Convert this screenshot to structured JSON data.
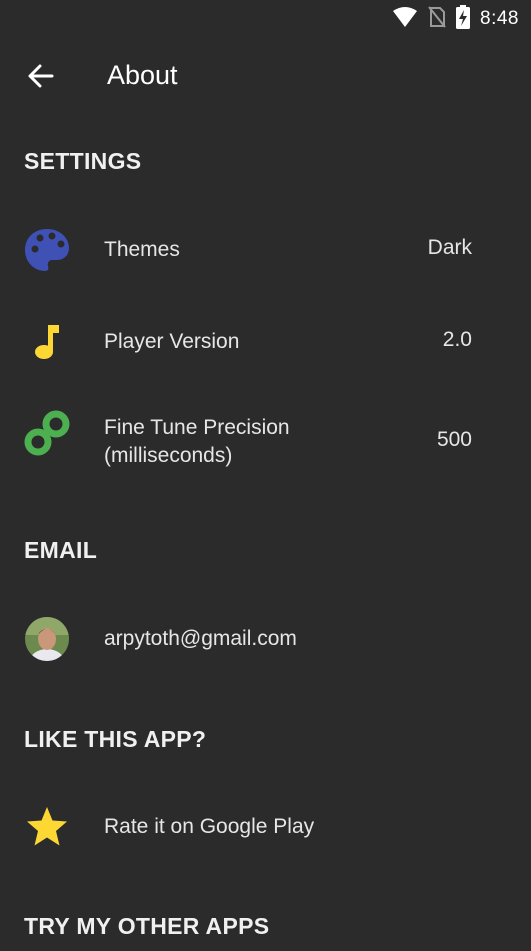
{
  "status_bar": {
    "time": "8:48"
  },
  "toolbar": {
    "title": "About"
  },
  "sections": {
    "settings": "SETTINGS",
    "email": "EMAIL",
    "like": "LIKE THIS APP?",
    "other": "TRY MY OTHER APPS"
  },
  "settings": {
    "themes": {
      "label": "Themes",
      "value": "Dark"
    },
    "player_version": {
      "label": "Player Version",
      "value": "2.0"
    },
    "fine_tune": {
      "label_line1": "Fine Tune Precision",
      "label_line2": "(milliseconds)",
      "value": "500"
    }
  },
  "email": {
    "address": "arpytoth@gmail.com"
  },
  "rate": {
    "label": "Rate it on Google Play"
  },
  "colors": {
    "background": "#2b2b2b",
    "palette_icon": "#3f51b5",
    "music_icon": "#fdd835",
    "link_icon": "#4caf50",
    "star_icon": "#fdd835"
  },
  "icons": [
    "wifi-icon",
    "no-sim-icon",
    "battery-charging-icon",
    "back-arrow-icon",
    "palette-icon",
    "music-note-icon",
    "link-icon",
    "star-icon"
  ]
}
